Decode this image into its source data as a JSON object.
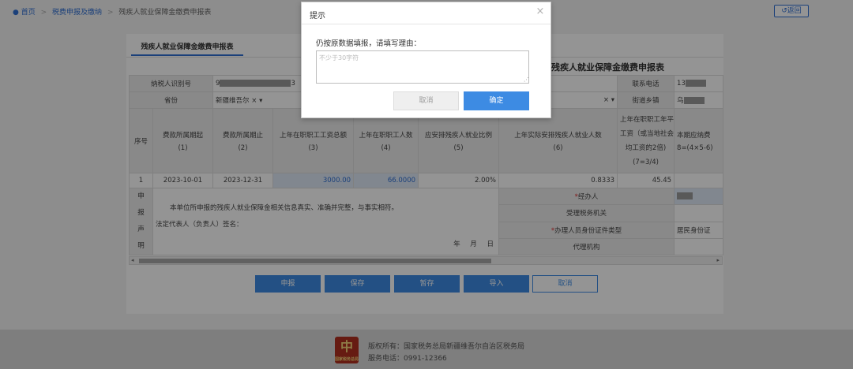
{
  "breadcrumb": {
    "home_icon": "location-pin-icon",
    "home": "首页",
    "level1": "税费申报及缴纳",
    "current": "残疾人就业保障金缴费申报表",
    "separator": ">"
  },
  "back_button": {
    "icon": "return-arrow-icon",
    "label": "返回"
  },
  "tab": {
    "label": "残疾人就业保障金缴费申报表"
  },
  "form_title": "残疾人就业保障金缴费申报表",
  "info_rows": {
    "taxpayer_id_label": "纳税人识别号",
    "taxpayer_id_suffix": "3",
    "taxpayer_id_prefix": "9",
    "phone_label": "联系电话",
    "phone_prefix": "13",
    "province_label": "省份",
    "province_value": "新疆维吾尔",
    "clear_glyph": "×",
    "dropdown_glyph": "▾",
    "street_label": "街道乡镇",
    "street_prefix": "乌"
  },
  "columns": [
    {
      "title": "序号",
      "sub": ""
    },
    {
      "title": "费款所属期起",
      "sub": "(1)"
    },
    {
      "title": "费款所属期止",
      "sub": "(2)"
    },
    {
      "title": "上年在职职工工资总额",
      "sub": "(3)"
    },
    {
      "title": "上年在职职工人数",
      "sub": "(4)"
    },
    {
      "title": "应安排残疾人就业比例",
      "sub": "(5)"
    },
    {
      "title": "上年实际安排残疾人就业人数",
      "sub": "(6)"
    },
    {
      "title": "上年在职职工年平均工资（或当地社会平均工资的2倍）",
      "sub": "(7=3/4)"
    },
    {
      "title": "本期应纳费",
      "sub": "8=(4×5-6)"
    }
  ],
  "col7_lines": [
    "上年在职职工年平均",
    "工资（或当地社会平",
    "均工资的2倍)",
    "(7=3/4)"
  ],
  "row1": {
    "seq": "1",
    "start": "2023-10-01",
    "end": "2023-12-31",
    "wage_total": "3000.00",
    "staff_count": "66.0000",
    "ratio": "2.00%",
    "disabled_count": "0.8333",
    "avg_wage": "45.45"
  },
  "declaration": {
    "side_label": [
      "申",
      "报",
      "声",
      "明"
    ],
    "statement": "本单位所申报的残疾人就业保障金相关信息真实、准确并完整，与事实相符。",
    "legal_rep": "法定代表人（负责人）签名：",
    "date_labels": [
      "年",
      "月",
      "日"
    ],
    "agent_label": "经办人",
    "agent_required": "*",
    "tax_authority_label": "受理税务机关",
    "id_type_label": "办理人员身份证件类型",
    "id_type_required": "*",
    "id_type_value": "居民身份证",
    "agency_label": "代理机构"
  },
  "scrollbar": {
    "left_arrow": "◂",
    "right_arrow": "▸"
  },
  "action_buttons": [
    {
      "key": "declare",
      "label": "申报"
    },
    {
      "key": "save",
      "label": "保存"
    },
    {
      "key": "temp_save",
      "label": "暂存"
    },
    {
      "key": "import",
      "label": "导入"
    },
    {
      "key": "cancel",
      "label": "取消"
    }
  ],
  "footer": {
    "logo_mark": "中",
    "logo_caption": "国家税务总局",
    "copyright": "版权所有：国家税务总局新疆维吾尔自治区税务局",
    "hotline": "服务电话：0991-12366"
  },
  "dialog": {
    "title": "提示",
    "close_glyph": "×",
    "prompt": "仍按原数据填报，请填写理由：",
    "placeholder": "不少于30字符",
    "grip_glyph": "⋰",
    "cancel_label": "取消",
    "ok_label": "确定"
  },
  "colors": {
    "primary": "#3d8be3",
    "link": "#2f6fd3",
    "required": "#e03030",
    "highlight_cell": "#dfe9f7",
    "footer_bg": "#d9d9d9",
    "logo_red": "#b03020"
  }
}
